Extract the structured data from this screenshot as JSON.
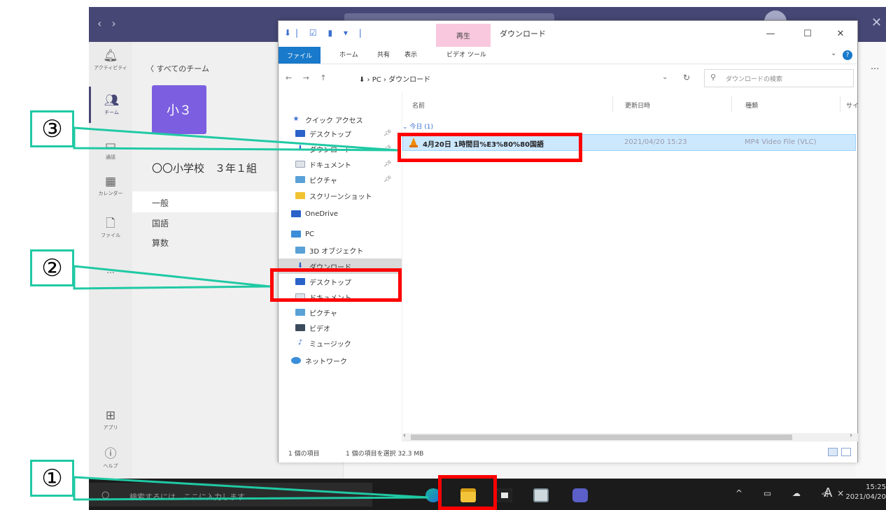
{
  "colors": {
    "teams_purple": "#464775",
    "team_tile": "#7b5fe0",
    "annotation_teal": "#20c9a4",
    "annotation_red": "#ff0000",
    "selection": "#cce8ff",
    "file_tab": "#1979ca",
    "context_tab": "#f9c8de"
  },
  "teams": {
    "rail": [
      {
        "icon": "bell-icon",
        "label": "アクティビティ"
      },
      {
        "icon": "teams-icon",
        "label": "チーム"
      },
      {
        "icon": "chat-icon",
        "label": "通話"
      },
      {
        "icon": "calendar-icon",
        "label": "カレンダー"
      },
      {
        "icon": "file-icon",
        "label": "ファイル"
      },
      {
        "icon": "more-icon",
        "label": "..."
      },
      {
        "icon": "apps-icon",
        "label": "アプリ"
      },
      {
        "icon": "help-icon",
        "label": "ヘルプ"
      }
    ],
    "back_link": "〈 すべてのチーム",
    "team_tile": "小３",
    "team_name": "〇〇小学校　３年１組",
    "channels": [
      "一般",
      "国語",
      "算数"
    ],
    "more_dots": "..."
  },
  "explorer": {
    "quick_access_toolbar": "⬇| ☑ ▮ ▾ |",
    "context_tab": "再生",
    "title": "ダウンロード",
    "window_buttons": {
      "minimize": "—",
      "maximize": "☐",
      "close": "✕"
    },
    "ribbon": {
      "file": "ファイル",
      "tabs": [
        "ホーム",
        "共有",
        "表示",
        "ビデオ ツール"
      ],
      "help": "?"
    },
    "nav_arrows": "← → ↑",
    "breadcrumb": "⬇ › PC › ダウンロード",
    "address_dropdown": "⌄",
    "refresh": "↻",
    "search_placeholder": "ダウンロードの検索",
    "nav_pane": [
      {
        "label": "クイック アクセス",
        "icon": "star-icon",
        "indent": 0,
        "pinned": false
      },
      {
        "label": "デスクトップ",
        "icon": "desktop-icon",
        "indent": 1,
        "pinned": true
      },
      {
        "label": "ダウンロード",
        "icon": "download-icon",
        "indent": 1,
        "pinned": true
      },
      {
        "label": "ドキュメント",
        "icon": "document-icon",
        "indent": 1,
        "pinned": true
      },
      {
        "label": "ピクチャ",
        "icon": "pictures-icon",
        "indent": 1,
        "pinned": true
      },
      {
        "label": "スクリーンショット",
        "icon": "folder-icon",
        "indent": 1,
        "pinned": false
      },
      {
        "label": "OneDrive",
        "icon": "onedrive-icon",
        "indent": 0,
        "pinned": false
      },
      {
        "label": "PC",
        "icon": "pc-icon",
        "indent": 0,
        "pinned": false
      },
      {
        "label": "3D オブジェクト",
        "icon": "3d-objects-icon",
        "indent": 1,
        "pinned": false
      },
      {
        "label": "ダウンロード",
        "icon": "download-icon",
        "indent": 1,
        "pinned": false
      },
      {
        "label": "デスクトップ",
        "icon": "desktop-icon",
        "indent": 1,
        "pinned": false
      },
      {
        "label": "ドキュメント",
        "icon": "document-icon",
        "indent": 1,
        "pinned": false
      },
      {
        "label": "ピクチャ",
        "icon": "pictures-icon",
        "indent": 1,
        "pinned": false
      },
      {
        "label": "ビデオ",
        "icon": "video-icon",
        "indent": 1,
        "pinned": false
      },
      {
        "label": "ミュージック",
        "icon": "music-icon",
        "indent": 1,
        "pinned": false
      },
      {
        "label": "ネットワーク",
        "icon": "network-icon",
        "indent": 0,
        "pinned": false
      }
    ],
    "columns": [
      "名前",
      "更新日時",
      "種類",
      "サイ"
    ],
    "group": "⌄ 今日 (1)",
    "file": {
      "name": "4月20日 1時間目%E3%80%80国語",
      "modified": "2021/04/20 15:23",
      "type": "MP4 Video File (VLC)"
    },
    "scroll_arrows": {
      "left": "‹",
      "right": "›"
    },
    "status": {
      "count": "1 個の項目",
      "selected": "1 個の項目を選択  32.3 MB"
    }
  },
  "taskbar": {
    "search_icon": "○",
    "search_text": "検索するには、ここに入力します",
    "apps": [
      "edge-icon",
      "file-explorer-icon",
      "camera-icon",
      "photos-icon",
      "teams-icon"
    ],
    "tray": "^ ▭ ☁ ◁×",
    "ime": "A",
    "time": "15:25",
    "date": "2021/04/20"
  },
  "annotations": {
    "step1": "①",
    "step2": "②",
    "step3": "③"
  }
}
